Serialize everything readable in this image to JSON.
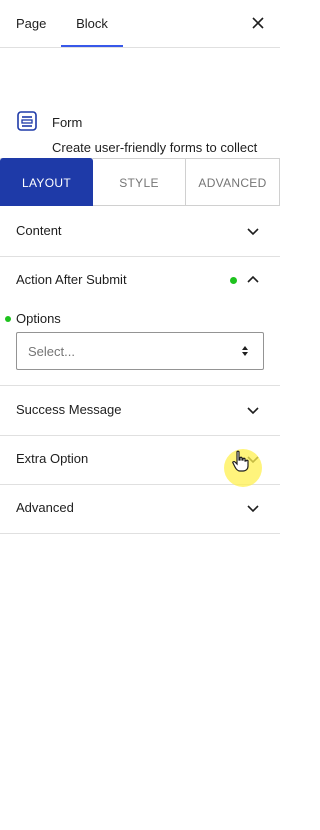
{
  "header": {
    "tabs": [
      {
        "label": "Page",
        "active": false
      },
      {
        "label": "Block",
        "active": true
      }
    ],
    "close_icon": "close-icon"
  },
  "block": {
    "icon": "form-icon",
    "title": "Form",
    "description": "Create user-friendly forms to collect information effortlessly."
  },
  "segments": [
    {
      "label": "LAYOUT",
      "active": true
    },
    {
      "label": "STYLE",
      "active": false
    },
    {
      "label": "ADVANCED",
      "active": false
    }
  ],
  "panels": [
    {
      "label": "Content",
      "expanded": false
    },
    {
      "label": "Action After Submit",
      "expanded": true,
      "modified": true
    },
    {
      "label": "Success Message",
      "expanded": false
    },
    {
      "label": "Extra Option",
      "expanded": false
    },
    {
      "label": "Advanced",
      "expanded": false
    }
  ],
  "options_field": {
    "label": "Options",
    "placeholder": "Select...",
    "modified": true
  },
  "colors": {
    "accent": "#1e3aa8",
    "tab_underline": "#3858e9",
    "modified_dot": "#1ec21e",
    "cursor_highlight": "#fff050"
  }
}
